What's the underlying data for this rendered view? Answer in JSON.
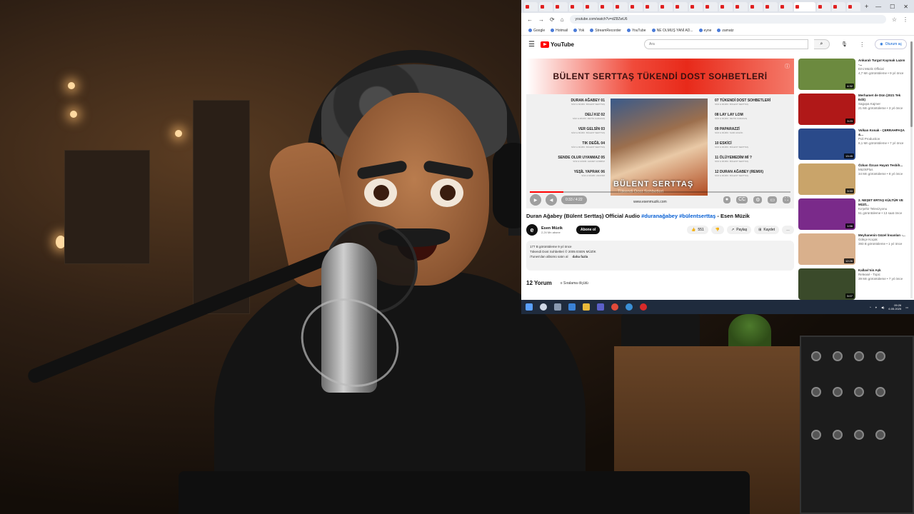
{
  "browser": {
    "url": "youtube.com/watch?v=dZ8ZwU6",
    "tabs_count": 22,
    "window_controls": [
      "—",
      "☐",
      "✕"
    ],
    "bookmarks": [
      "Google",
      "Hotmail",
      "Yok",
      "StreamRecorder",
      "YouTube",
      "NE OLMUŞ YANİ AD...",
      "eyne",
      "zamatz"
    ]
  },
  "youtube": {
    "logo_text": "YouTube",
    "search_placeholder": "Ara",
    "signin_label": "Oturum aç",
    "player": {
      "banner_text": "BÜLENT SERTTAŞ  TÜKENDİ DOST SOHBETLERİ",
      "tracks_left": [
        {
          "title": "DURAN AĞABEY 01",
          "sub": "SÖZ & MÜZİK: BÜLENT SERTTAŞ"
        },
        {
          "title": "DELİ KIZ 02",
          "sub": "SÖZ & MÜZİK: METİN KARAKAŞ"
        },
        {
          "title": "VER GELSİN 03",
          "sub": "SÖZ & MÜZİK: BÜLENT SERTTAŞ"
        },
        {
          "title": "TIK DEĞİL 04",
          "sub": "SÖZ & MÜZİK: BÜLENT SERTTAŞ"
        },
        {
          "title": "SENDE OLUR UYANMAZ 05",
          "sub": "SÖZ & MÜZİK: AHMET GÜRBÜZ"
        },
        {
          "title": "YEŞİL YAPRAK 06",
          "sub": "SÖZ & MÜZİK: ANONİM"
        }
      ],
      "tracks_right": [
        {
          "title": "07 TÜKENDİ DOST SOHBETLERİ",
          "sub": "SÖZ & MÜZİK: BÜLENT SERTTAŞ"
        },
        {
          "title": "08 LAY LAY LOM",
          "sub": "SÖZ & MÜZİK: METİN KARAKAŞ"
        },
        {
          "title": "09 PAPARAZZİ",
          "sub": "SÖZ & MÜZİK: SAMİ AKGÖK"
        },
        {
          "title": "10 ESKİCİ",
          "sub": "SÖZ & MÜZİK: BÜLENT SERTTAŞ"
        },
        {
          "title": "11 ÖLÜYEMEDİM Mİ ?",
          "sub": "SÖZ & MÜZİK: BÜLENT SERTTAŞ"
        },
        {
          "title": "12 DURAN AĞABEY (REMIX)",
          "sub": "SÖZ & MÜZİK: BÜLENT SERTTAŞ"
        }
      ],
      "cover_name": "BÜLENT SERTTAŞ",
      "cover_subtitle": "Tükendi Dost Sohbetleri",
      "time": "0:33 / 4:22",
      "progress": 0.13,
      "watermark": "www.esenmuzik.com"
    },
    "video": {
      "title": "Duran Ağabey (Bülent Serttaş) Official Audio ",
      "hashtags": "#duranağabey #bülentserttaş",
      "title_suffix": " - Esen Müzik",
      "channel": "Esen Müzik",
      "subscribers": "2,24 Mn abone",
      "subscribe_label": "Abone ol",
      "likes": "551",
      "share_label": "Paylaş",
      "save_label": "Kaydet",
      "description_line1": "177 B görüntüleme  9 yıl önce",
      "description_line2": "Tükendi Dost Sohbetleri © 2005 ESEN MÜZİK",
      "description_line3": "iTunes'dan albümü satın al",
      "more_label": "daha fazla",
      "comments_count": "12 Yorum",
      "sort_label": "Sıralama ölçütü"
    },
    "related": [
      {
        "title": "Ankaralı Turgut Kaymak Lazım -...",
        "channel": "Emi Müzik Official",
        "meta": "4,7 Mn görüntüleme • 9 yıl önce",
        "duration": "4:32",
        "color": "#6c8a3f"
      },
      {
        "title": "Merhamet de Dün (2021 Tek Edit)",
        "channel": "Sagopa Kajmer",
        "meta": "21 Mn görüntüleme • 3 yıl önce",
        "duration": "3:23",
        "color": "#b01818"
      },
      {
        "title": "Volkan Konak - ÇERRAHPAŞA &...",
        "channel": "Poli Production",
        "meta": "8,1 Mn görüntüleme • 7 yıl önce",
        "duration": "13:45",
        "color": "#2a4a8a"
      },
      {
        "title": "Özkan Özcan Hayatı Tesbih...",
        "channel": "MüzikPlus",
        "meta": "34 Mn görüntüleme • 8 yıl önce",
        "duration": "3:33",
        "color": "#c9a46a"
      },
      {
        "title": "2. NEŞET ERTAŞ KÜLTÜR VE MÜZİ...",
        "channel": "Kırşehir Televizyonu",
        "meta": "51 görüntüleme • 13 saat önce",
        "duration": "1:56",
        "color": "#7a2a8a"
      },
      {
        "title": "Meyhanenin Güzel İnsanları -...",
        "channel": "Gökçe Koçak",
        "meta": "393 B görüntüleme • 1 yıl önce",
        "duration": "12:26",
        "color": "#d9b08c"
      },
      {
        "title": "Kallavi'nin Aşk",
        "channel": "Releasé - Topic",
        "meta": "39 Mn görüntüleme • 7 yıl önce",
        "duration": "5:07",
        "color": "#3a4a2a"
      }
    ]
  },
  "taskbar": {
    "time": "09:26",
    "date": "6.05.2025"
  }
}
